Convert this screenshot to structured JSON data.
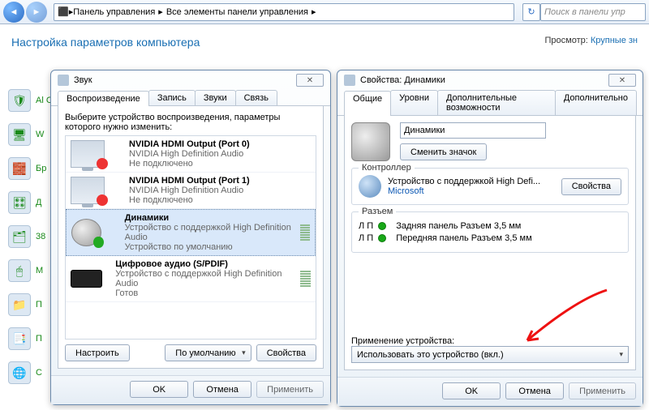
{
  "nav": {
    "crumb1": "Панель управления",
    "crumb2": "Все элементы панели управления",
    "search_placeholder": "Поиск в панели упр"
  },
  "page": {
    "title": "Настройка параметров компьютера",
    "view_lbl": "Просмотр:",
    "view_value": "Крупные зн"
  },
  "bg": [
    {
      "icon": "🛡",
      "text": "Al\nСе"
    },
    {
      "icon": "🖥",
      "text": "W"
    },
    {
      "icon": "🧱",
      "text": "Бр"
    },
    {
      "icon": "🎛",
      "text": "Д"
    },
    {
      "icon": "🗂",
      "text": "38"
    },
    {
      "icon": "🖱",
      "text": "М"
    },
    {
      "icon": "📁",
      "text": "П"
    },
    {
      "icon": "📑",
      "text": "П"
    },
    {
      "icon": "🌐",
      "text": "С"
    }
  ],
  "sound": {
    "title": "Звук",
    "tabs": [
      "Воспроизведение",
      "Запись",
      "Звуки",
      "Связь"
    ],
    "intro": "Выберите устройство воспроизведения, параметры которого нужно изменить:",
    "devices": [
      {
        "name": "NVIDIA HDMI Output (Port 0)",
        "sub": "NVIDIA High Definition Audio",
        "status": "Не подключено",
        "kind": "monitor",
        "badge": "red"
      },
      {
        "name": "NVIDIA HDMI Output (Port 1)",
        "sub": "NVIDIA High Definition Audio",
        "status": "Не подключено",
        "kind": "monitor",
        "badge": "red"
      },
      {
        "name": "Динамики",
        "sub": "Устройство с поддержкой High Definition Audio",
        "status": "Устройство по умолчанию",
        "kind": "speaker",
        "badge": "green"
      },
      {
        "name": "Цифровое аудио (S/PDIF)",
        "sub": "Устройство с поддержкой High Definition Audio",
        "status": "Готов",
        "kind": "spdif",
        "badge": ""
      }
    ],
    "configure": "Настроить",
    "default": "По умолчанию",
    "properties": "Свойства",
    "ok": "OK",
    "cancel": "Отмена",
    "apply": "Применить"
  },
  "props": {
    "title": "Свойства: Динамики",
    "tabs": [
      "Общие",
      "Уровни",
      "Дополнительные возможности",
      "Дополнительно"
    ],
    "name_value": "Динамики",
    "change_icon": "Сменить значок",
    "controller_legend": "Контроллер",
    "controller_name": "Устройство с поддержкой High Defi...",
    "controller_props": "Свойства",
    "vendor": "Microsoft",
    "jacks_legend": "Разъем",
    "lr": "Л П",
    "jack1": "Задняя панель Разъем 3,5 мм",
    "jack2": "Передняя панель Разъем 3,5 мм",
    "usage_label": "Применение устройства:",
    "usage_value": "Использовать это устройство (вкл.)",
    "ok": "OK",
    "cancel": "Отмена",
    "apply": "Применить"
  }
}
